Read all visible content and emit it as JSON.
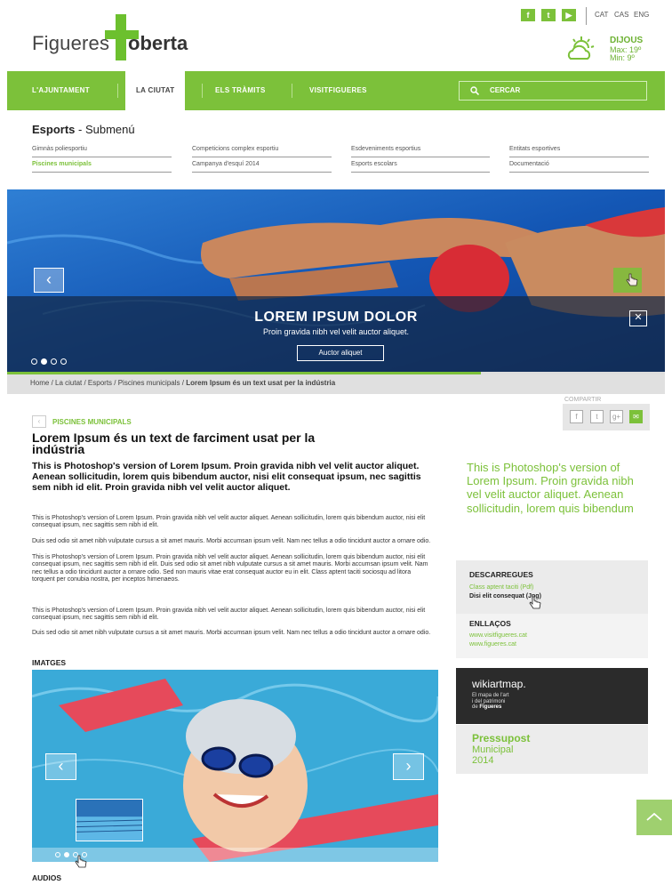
{
  "header": {
    "logo_word1": "Figueres",
    "logo_word2": "oberta",
    "social": [
      {
        "icon": "facebook-icon",
        "glyph": "f"
      },
      {
        "icon": "twitter-icon",
        "glyph": "t"
      },
      {
        "icon": "youtube-icon",
        "glyph": "▶"
      }
    ],
    "languages": [
      "CAT",
      "CAS",
      "ENG"
    ],
    "weather": {
      "day": "DIJOUS",
      "max": "Max: 19º",
      "min": "Min: 9º",
      "icon": "sun-cloud-icon"
    }
  },
  "nav": {
    "items": [
      "L'AJUNTAMENT",
      "LA CIUTAT",
      "ELS TRÀMITS",
      "VISITFIGUERES"
    ],
    "active_index": 1,
    "search_label": "CERCAR",
    "color": "#7cc13a"
  },
  "submenu": {
    "title_bold": "Esports",
    "title_rest": " - Submenú",
    "columns": [
      [
        "Gimnàs poliesportiu",
        "Piscines municipals"
      ],
      [
        "Competicions complex esportiu",
        "Campanya d'esquí 2014"
      ],
      [
        "Esdeveniments esportius",
        "Esports escolars"
      ],
      [
        "Entitats esportives",
        "Documentació"
      ]
    ],
    "selected": "Piscines municipals"
  },
  "hero": {
    "title": "LOREM IPSUM DOLOR",
    "subtitle": "Proin gravida nibh vel velit auctor aliquet.",
    "button": "Auctor aliquet",
    "prev_glyph": "‹",
    "close_glyph": "✕",
    "dots_total": 4,
    "active_dot": 1,
    "progress": 0.72
  },
  "breadcrumb": {
    "path": "Home / La ciutat / Esports / Piscines municipals / ",
    "current": "Lorem Ipsum és un text usat per la indústria"
  },
  "share": {
    "label": "COMPARTIR",
    "buttons": [
      {
        "icon": "facebook-icon",
        "glyph": "f"
      },
      {
        "icon": "twitter-icon",
        "glyph": "t"
      },
      {
        "icon": "googleplus-icon",
        "glyph": "g+"
      },
      {
        "icon": "email-icon",
        "glyph": "✉"
      }
    ]
  },
  "article": {
    "back_glyph": "‹",
    "section": "PISCINES MUNICIPALS",
    "title": "Lorem Ipsum és un text de farciment usat per la indústria",
    "lead": "This is Photoshop's version  of Lorem Ipsum. Proin gravida nibh vel velit auctor aliquet. Aenean sollicitudin, lorem quis bibendum auctor, nisi elit consequat ipsum, nec sagittis sem nibh id elit. Proin gravida nibh vel velit auctor aliquet.",
    "p1": "This is Photoshop's version  of Lorem Ipsum. Proin gravida nibh vel velit auctor aliquet. Aenean sollicitudin, lorem quis bibendum auctor, nisi elit consequat ipsum, nec sagittis sem nibh id elit.",
    "p2": "Duis sed odio sit amet nibh vulputate cursus a sit amet mauris. Morbi accumsan ipsum velit. Nam nec tellus a odio tincidunt auctor a ornare odio.",
    "p3": "This is Photoshop's version  of Lorem Ipsum. Proin gravida nibh vel velit auctor aliquet. Aenean sollicitudin, lorem quis bibendum auctor, nisi elit consequat ipsum, nec sagittis sem nibh id elit. Duis sed odio sit amet nibh vulputate cursus a sit amet mauris. Morbi accumsan ipsum velit. Nam nec tellus a odio tincidunt auctor a ornare odio. Sed non  mauris vitae erat consequat auctor eu in elit. Class aptent taciti sociosqu ad litora torquent per conubia nostra, per inceptos himenaeos.",
    "p4": "This is Photoshop's version  of Lorem Ipsum. Proin gravida nibh vel velit auctor aliquet. Aenean sollicitudin, lorem quis bibendum auctor, nisi elit consequat ipsum, nec sagittis sem nibh id elit.",
    "p5": "Duis sed odio sit amet nibh vulputate cursus a sit amet mauris. Morbi accumsan ipsum velit. Nam nec tellus a odio tincidunt auctor a ornare odio.",
    "images_label": "IMATGES",
    "gallery": {
      "prev_glyph": "‹",
      "next_glyph": "›",
      "dots_total": 4,
      "active_dot": 1
    },
    "audios_label": "AUDIOS"
  },
  "sidebar": {
    "quote": "This is Photoshop's version  of Lorem Ipsum. Proin gravida nibh vel velit auctor aliquet. Aenean sollicitudin, lorem quis bibendum",
    "downloads": {
      "title": "DESCARREGUES",
      "items": [
        "Class aptent taciti (Pdf)",
        "Disi elit consequat (Jpg)"
      ]
    },
    "links": {
      "title": "ENLLAÇOS",
      "items": [
        "www.visitfigueres.cat",
        "www.figueres.cat"
      ]
    },
    "wikiart": {
      "title": "wikiartmap.",
      "line1": "El mapa de l'art",
      "line2": "i del patrimoni",
      "line3_prefix": "de ",
      "line3_bold": "Figueres"
    },
    "pressupost": {
      "title": "Pressupost",
      "line1": "Municipal",
      "line2": "2014"
    }
  },
  "to_top_icon": "chevron-up-icon"
}
